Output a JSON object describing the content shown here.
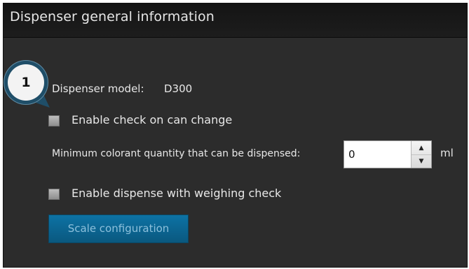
{
  "panel": {
    "title": "Dispenser general information"
  },
  "dispenser_model": {
    "label": "Dispenser model:",
    "value": "D300"
  },
  "check_on_can_change": {
    "label": "Enable check on can change",
    "checked": false
  },
  "min_colorant_quantity": {
    "label": "Minimum colorant quantity that can be dispensed:",
    "value": "0",
    "unit": "ml"
  },
  "weighing_check": {
    "label": "Enable dispense with weighing check",
    "checked": false
  },
  "scale_configuration": {
    "label": "Scale configuration",
    "enabled": false
  },
  "callout": {
    "number": "1"
  },
  "colors": {
    "panel_bg": "#2c2c2c",
    "header_bg": "#181818",
    "button_bg": "#0b649a",
    "callout_ring": "#1f4e68"
  }
}
